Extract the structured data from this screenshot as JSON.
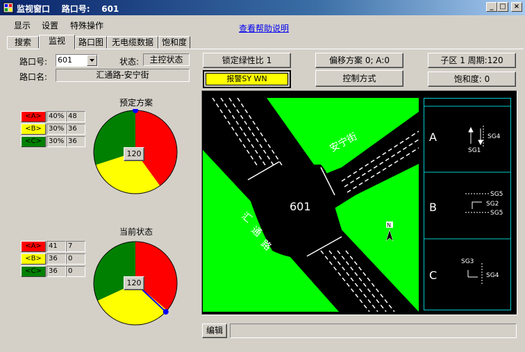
{
  "window": {
    "title": "监视窗口    路口号:    601",
    "minimize": "_",
    "maximize": "□",
    "close": "×"
  },
  "menu": {
    "display": "显示",
    "settings": "设置",
    "special": "特殊操作",
    "help": "查看帮助说明"
  },
  "tabs": [
    "搜索",
    "监视",
    "路口图",
    "无电缆数据",
    "饱和度"
  ],
  "junction": {
    "number_label": "路口号:",
    "number_value": "601",
    "status_label": "状态:",
    "status_value": "主控状态",
    "name_label": "路口名:",
    "name_value": "汇通路-安宁街"
  },
  "buttons": {
    "lock_ratio": "锁定绿性比 1",
    "offset_plan": "偏移方案 0; A:0",
    "subzone_cycle": "子区 1 周期:120",
    "alarm": "报警SY WN",
    "control_mode": "控制方式",
    "saturation": "饱和度: 0",
    "edit": "编辑"
  },
  "planned": {
    "title": "预定方案",
    "center": "120",
    "rows": [
      {
        "label": "<A>",
        "pct": "40%",
        "val": "48",
        "color": "#ff0000"
      },
      {
        "label": "<B>",
        "pct": "30%",
        "val": "36",
        "color": "#ffff00"
      },
      {
        "label": "<C>",
        "pct": "30%",
        "val": "36",
        "color": "#008000"
      }
    ],
    "slices": [
      40,
      30,
      30
    ],
    "pointer_fraction": 0.0
  },
  "current": {
    "title": "当前状态",
    "center": "120",
    "rows": [
      {
        "label": "<A>",
        "pct": "41",
        "val": "7",
        "color": "#ff0000"
      },
      {
        "label": "<B>",
        "pct": "36",
        "val": "0",
        "color": "#ffff00"
      },
      {
        "label": "<C>",
        "pct": "36",
        "val": "0",
        "color": "#008000"
      }
    ],
    "slices": [
      41,
      36,
      36
    ],
    "pointer_fraction": 0.37
  },
  "map": {
    "junction_id": "601",
    "road_1": "安宁街",
    "road_2_chars": [
      "汇",
      "通",
      "路"
    ],
    "north": "N"
  },
  "phases": {
    "labels": [
      "A",
      "B",
      "C"
    ],
    "a_signals": [
      "SG1",
      "SG4"
    ],
    "b_signals": [
      "SG5",
      "SG2",
      "SG5"
    ],
    "c_signals": [
      "SG3",
      "SG4"
    ]
  },
  "colors": {
    "title_bar": "#0a246a",
    "grass": "#00ff00",
    "road": "#000000",
    "phase_red": "#ff0000",
    "phase_yellow": "#ffff00",
    "phase_green": "#008000",
    "pointer": "#0000ff",
    "phase_border": "#00cccc"
  },
  "icons": [
    "window-app-icon",
    "dropdown-arrow-icon",
    "north-arrow-icon",
    "signal-arrow-icon"
  ]
}
